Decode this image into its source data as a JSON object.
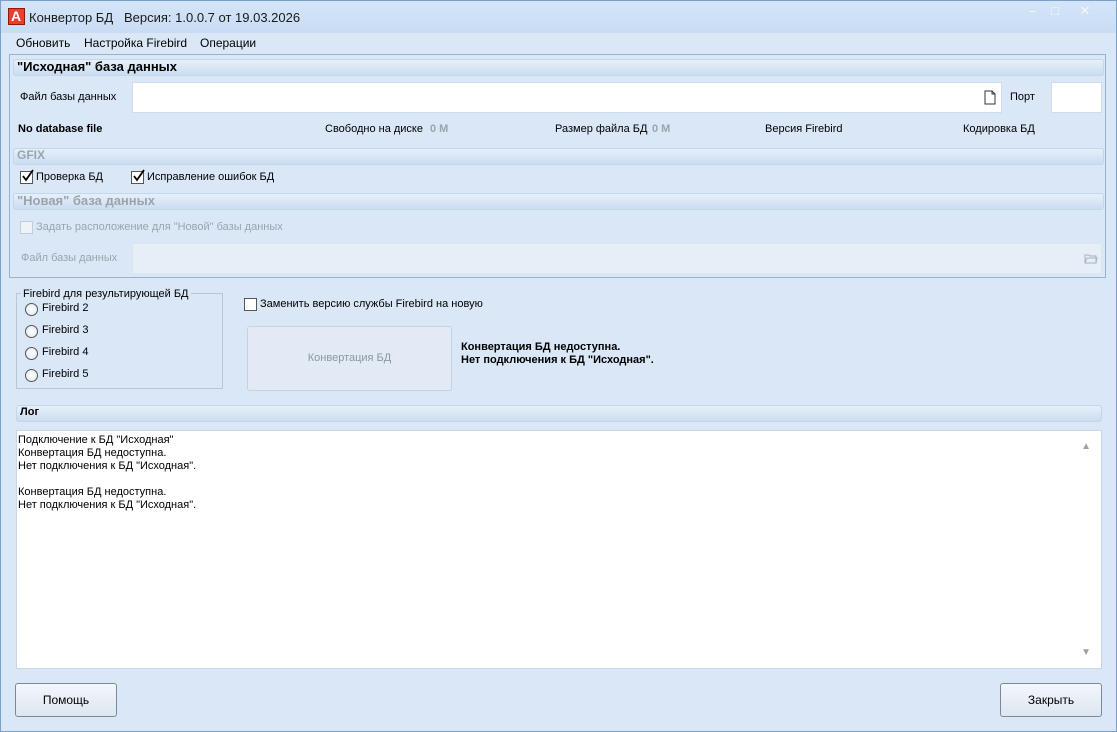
{
  "window": {
    "title": "Конвертор БД",
    "version": "Версия: 1.0.0.7 от 19.03.2026"
  },
  "menu": [
    "Обновить",
    "Настройка Firebird",
    "Операции"
  ],
  "source": {
    "header": "\"Исходная\" база данных",
    "file_label": "Файл базы данных",
    "file_value": "",
    "port_label": "Порт",
    "port_value": "",
    "status": "No database file",
    "free_space_label": "Свободно на диске",
    "free_space_value": "0 M",
    "file_size_label": "Размер файла  БД",
    "file_size_value": "0 M",
    "firebird_version_label": "Версия Firebird",
    "encoding_label": "Кодировка БД"
  },
  "gfix": {
    "header": "GFIX",
    "check_db": {
      "label": "Проверка БД",
      "checked": true
    },
    "fix_errors": {
      "label": "Исправление ошибок БД",
      "checked": true
    }
  },
  "target": {
    "header": "\"Новая\" база данных",
    "set_location_label": "Задать расположение для \"Новой\" базы данных",
    "file_label": "Файл базы данных"
  },
  "firebird_result": {
    "legend": "Firebird для результирующей БД",
    "options": [
      "Firebird 2",
      "Firebird 3",
      "Firebird 4",
      "Firebird 5"
    ]
  },
  "replace_service": {
    "label": "Заменить версию службы Firebird на новую",
    "checked": false
  },
  "convert_button": "Конвертация БД",
  "convert_status": [
    "Конвертация БД недоступна.",
    "Нет подключения к БД \"Исходная\"."
  ],
  "log": {
    "header": "Лог",
    "lines": [
      "Подключение к БД \"Исходная\"",
      "Конвертация БД недоступна.",
      "Нет подключения к БД \"Исходная\".",
      "",
      "Конвертация БД недоступна.",
      "Нет подключения к БД \"Исходная\"."
    ]
  },
  "buttons": {
    "help": "Помощь",
    "close": "Закрыть"
  },
  "colors": {
    "accent": "#e8402c",
    "window_bg": "#d9e7f6",
    "disabled_text": "#9aa4ae"
  }
}
